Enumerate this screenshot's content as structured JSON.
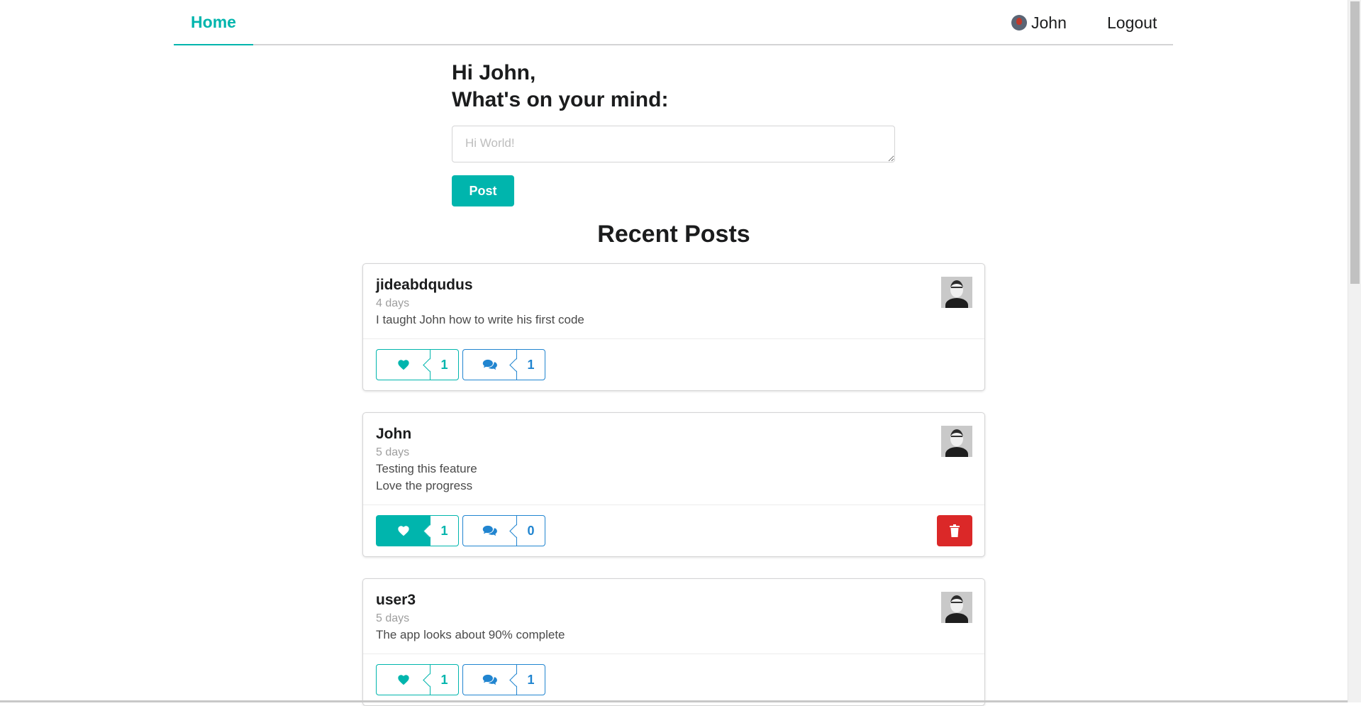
{
  "nav": {
    "home_label": "Home",
    "user_label": "John",
    "logout_label": "Logout"
  },
  "composer": {
    "greeting_line1": "Hi John,",
    "greeting_line2": "What's on your mind:",
    "placeholder": "Hi World!",
    "value": "",
    "post_label": "Post"
  },
  "recent_title": "Recent Posts",
  "posts": [
    {
      "author": "jideabdqudus",
      "time": "4 days",
      "text": "I taught John how to write his first code",
      "likes": "1",
      "comments": "1",
      "liked": false,
      "deletable": false
    },
    {
      "author": "John",
      "time": "5 days",
      "text": "Testing this feature\nLove the progress",
      "likes": "1",
      "comments": "0",
      "liked": true,
      "deletable": true
    },
    {
      "author": "user3",
      "time": "5 days",
      "text": "The app looks about 90% complete",
      "likes": "1",
      "comments": "1",
      "liked": false,
      "deletable": false
    }
  ],
  "icons": {
    "like": "heart-icon",
    "comment": "comment-icon",
    "delete": "trash-icon",
    "avatar": "user-avatar"
  },
  "colors": {
    "accent": "#00b5ad",
    "comment": "#2185d0",
    "danger": "#db2828"
  }
}
